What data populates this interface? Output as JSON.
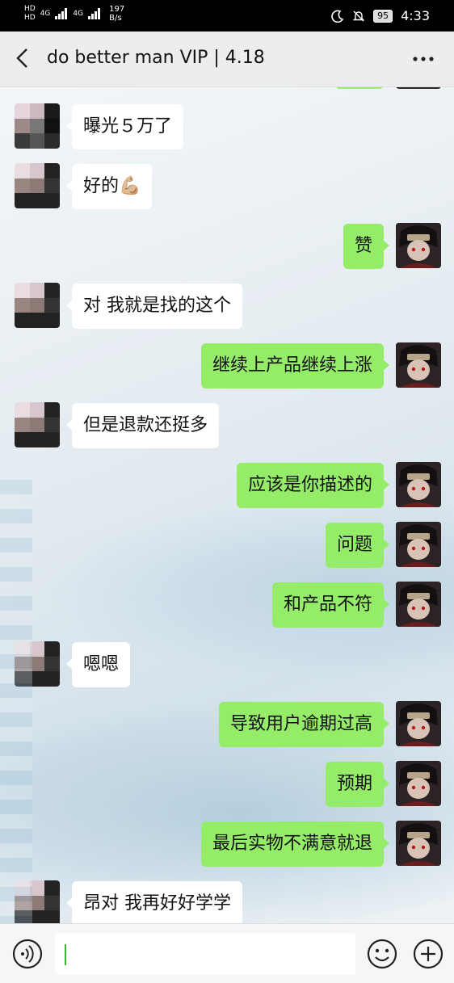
{
  "status_bar": {
    "net_top": "HD",
    "net_bottom": "HD",
    "signal_labels": [
      "4G",
      "4G"
    ],
    "speed_value": "197",
    "speed_unit": "B/s",
    "battery": "95",
    "time": "4:33"
  },
  "header": {
    "title": "do  better  man VIP | 4.18"
  },
  "messages": [
    {
      "side": "left",
      "text": "曝光５万了"
    },
    {
      "side": "left",
      "text": "好的💪🏼"
    },
    {
      "side": "right",
      "text": "赞"
    },
    {
      "side": "left",
      "text": "对  我就是找的这个"
    },
    {
      "side": "right",
      "text": "继续上产品继续上涨"
    },
    {
      "side": "left",
      "text": "但是退款还挺多"
    },
    {
      "side": "right",
      "text": "应该是你描述的"
    },
    {
      "side": "right",
      "text": "问题"
    },
    {
      "side": "right",
      "text": "和产品不符"
    },
    {
      "side": "left",
      "text": "嗯嗯"
    },
    {
      "side": "right",
      "text": "导致用户逾期过高"
    },
    {
      "side": "right",
      "text": "预期"
    },
    {
      "side": "right",
      "text": "最后实物不满意就退"
    },
    {
      "side": "left",
      "text": "昂对   我再好好学学"
    }
  ],
  "input_bar": {
    "placeholder": ""
  },
  "colors": {
    "outgoing_bubble": "#95ec69",
    "incoming_bubble": "#ffffff",
    "caret": "#3fb839"
  },
  "icons": [
    "back-icon",
    "more-icon",
    "voice-icon",
    "emoji-icon",
    "plus-icon"
  ]
}
